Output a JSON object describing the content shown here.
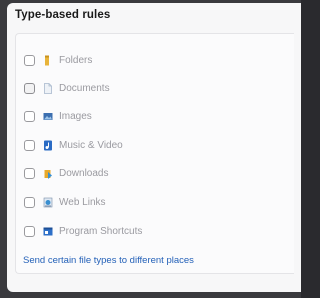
{
  "section": {
    "title": "Type-based rules"
  },
  "rules": [
    {
      "label": "Folders",
      "icon": "folder-icon",
      "color": "#e8b43a",
      "checked": false
    },
    {
      "label": "Documents",
      "icon": "document-icon",
      "color": "#a8b8cc",
      "checked": false
    },
    {
      "label": "Images",
      "icon": "image-icon",
      "color": "#3c6fb0",
      "checked": false
    },
    {
      "label": "Music & Video",
      "icon": "music-video-icon",
      "color": "#2a6bc4",
      "checked": false
    },
    {
      "label": "Downloads",
      "icon": "downloads-icon",
      "color": "#e8a92a",
      "checked": false
    },
    {
      "label": "Web Links",
      "icon": "web-links-icon",
      "color": "#3a8fd0",
      "checked": false
    },
    {
      "label": "Program Shortcuts",
      "icon": "program-shortcuts-icon",
      "color": "#2d6fc8",
      "checked": false
    }
  ],
  "footer": {
    "link_text": "Send certain file types to different places"
  },
  "colors": {
    "link": "#2461b8",
    "label": "#9a9aa0"
  }
}
